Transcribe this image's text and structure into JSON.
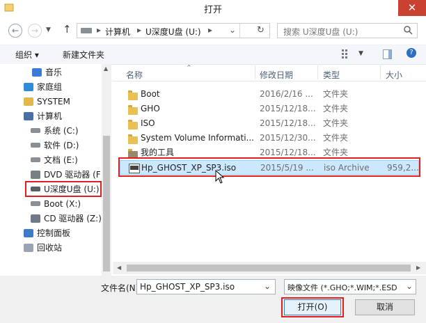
{
  "window": {
    "title": "打开",
    "close_glyph": "✕"
  },
  "nav": {
    "back_glyph": "←",
    "forward_glyph": "→",
    "up_glyph": "↑",
    "breadcrumb": [
      "计算机",
      "U深度U盘 (U:)"
    ],
    "dropdown_glyph": "⌄",
    "refresh_glyph": "↻",
    "search_placeholder": "搜索 U深度U盘 (U:)"
  },
  "toolbar": {
    "organize": "组织 ▾",
    "new_folder": "新建文件夹"
  },
  "tree": [
    {
      "label": "音乐",
      "icon": "music-icon"
    },
    {
      "label": "家庭组",
      "icon": "homegroup-icon"
    },
    {
      "label": "SYSTEM",
      "icon": "user-folder-icon"
    },
    {
      "label": "计算机",
      "icon": "computer-icon"
    },
    {
      "label": "系统 (C:)",
      "icon": "drive-icon"
    },
    {
      "label": "软件 (D:)",
      "icon": "drive-icon"
    },
    {
      "label": "文档 (E:)",
      "icon": "drive-icon"
    },
    {
      "label": "DVD 驱动器 (F",
      "icon": "dvd-icon"
    },
    {
      "label": "U深度U盘 (U:)",
      "icon": "usb-drive-icon"
    },
    {
      "label": "Boot (X:)",
      "icon": "drive-icon"
    },
    {
      "label": "CD 驱动器 (Z:)",
      "icon": "cd-icon"
    },
    {
      "label": "控制面板",
      "icon": "control-panel-icon"
    },
    {
      "label": "回收站",
      "icon": "recycle-bin-icon"
    }
  ],
  "columns": {
    "name": "名称",
    "modified": "修改日期",
    "type": "类型",
    "size": "大小"
  },
  "files": [
    {
      "name": "Boot",
      "date": "2016/2/16 ...",
      "type": "文件夹",
      "size": ""
    },
    {
      "name": "GHO",
      "date": "2015/12/18...",
      "type": "文件夹",
      "size": ""
    },
    {
      "name": "ISO",
      "date": "2015/12/18...",
      "type": "文件夹",
      "size": ""
    },
    {
      "name": "System Volume Informati...",
      "date": "2015/12/30...",
      "type": "文件夹",
      "size": ""
    },
    {
      "name": "我的工具",
      "date": "2015/12/18...",
      "type": "文件夹",
      "size": ""
    },
    {
      "name": "Hp_GHOST_XP_SP3.iso",
      "date": "2015/5/19 ...",
      "type": "iso Archive",
      "size": "959,2..."
    }
  ],
  "bottom": {
    "filename_label": "文件名(N):",
    "filename_value": "Hp_GHOST_XP_SP3.iso",
    "filter_value": "映像文件 (*.GHO;*.WIM;*.ESD",
    "open_button": "打开(O)",
    "cancel_button": "取消"
  },
  "colors": {
    "selection": "#cce8ff",
    "highlight_border": "#e02020",
    "close_red": "#c94130"
  }
}
